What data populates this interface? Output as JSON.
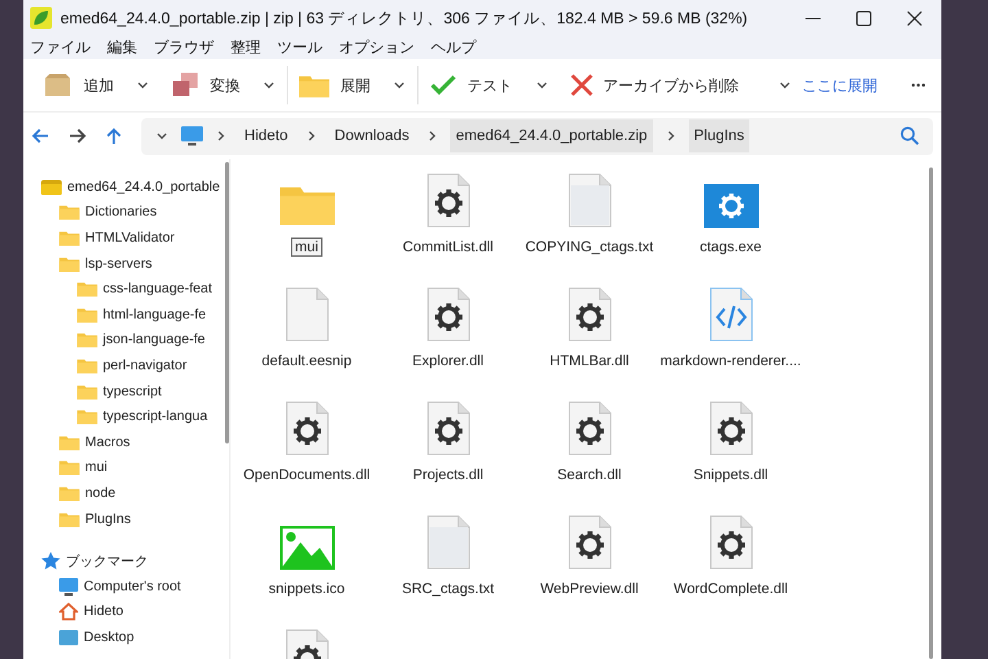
{
  "window": {
    "title": "emed64_24.4.0_portable.zip | zip | 63 ディレクトリ、306 ファイル、182.4 MB > 59.6 MB (32%)"
  },
  "menu": [
    "ファイル",
    "編集",
    "ブラウザ",
    "整理",
    "ツール",
    "オプション",
    "ヘルプ"
  ],
  "toolbar": {
    "buttons": [
      {
        "kind": "add",
        "label": "追加"
      },
      {
        "kind": "convert",
        "label": "変換"
      },
      {
        "kind": "extract",
        "label": "展開"
      },
      {
        "kind": "test",
        "label": "テスト"
      },
      {
        "kind": "delete",
        "label": "アーカイブから削除"
      }
    ],
    "link": "ここに展開"
  },
  "address": {
    "crumbs": [
      {
        "label": "Hideto",
        "selected": false
      },
      {
        "label": "Downloads",
        "selected": false
      },
      {
        "label": "emed64_24.4.0_portable.zip",
        "selected": true
      },
      {
        "label": "PlugIns",
        "selected": true
      }
    ]
  },
  "sidebar": {
    "tree": [
      {
        "label": "emed64_24.4.0_portable",
        "kind": "archive",
        "children": [
          {
            "label": "Dictionaries",
            "kind": "folder"
          },
          {
            "label": "HTMLValidator",
            "kind": "folder"
          },
          {
            "label": "lsp-servers",
            "kind": "folder",
            "children": [
              {
                "label": "css-language-feat",
                "kind": "folder"
              },
              {
                "label": "html-language-fe",
                "kind": "folder"
              },
              {
                "label": "json-language-fe",
                "kind": "folder"
              },
              {
                "label": "perl-navigator",
                "kind": "folder"
              },
              {
                "label": "typescript",
                "kind": "folder"
              },
              {
                "label": "typescript-langua",
                "kind": "folder"
              }
            ]
          },
          {
            "label": "Macros",
            "kind": "folder"
          },
          {
            "label": "mui",
            "kind": "folder"
          },
          {
            "label": "node",
            "kind": "folder"
          },
          {
            "label": "PlugIns",
            "kind": "folder"
          }
        ]
      }
    ],
    "bookmarks": {
      "label": "ブックマーク",
      "items": [
        {
          "label": "Computer's root",
          "kind": "computer"
        },
        {
          "label": "Hideto",
          "kind": "home"
        },
        {
          "label": "Desktop",
          "kind": "desktop"
        }
      ]
    }
  },
  "files": [
    {
      "name": "mui",
      "kind": "folder",
      "selected": true
    },
    {
      "name": "CommitList.dll",
      "kind": "gear",
      "selected": false
    },
    {
      "name": "COPYING_ctags.txt",
      "kind": "blank",
      "selected": false
    },
    {
      "name": "ctags.exe",
      "kind": "exe",
      "selected": false
    },
    {
      "name": "default.eesnip",
      "kind": "plain",
      "selected": false
    },
    {
      "name": "Explorer.dll",
      "kind": "gear",
      "selected": false
    },
    {
      "name": "HTMLBar.dll",
      "kind": "gear",
      "selected": false
    },
    {
      "name": "markdown-renderer....",
      "kind": "code",
      "selected": false
    },
    {
      "name": "OpenDocuments.dll",
      "kind": "gear",
      "selected": false
    },
    {
      "name": "Projects.dll",
      "kind": "gear",
      "selected": false
    },
    {
      "name": "Search.dll",
      "kind": "gear",
      "selected": false
    },
    {
      "name": "Snippets.dll",
      "kind": "gear",
      "selected": false
    },
    {
      "name": "snippets.ico",
      "kind": "image",
      "selected": false
    },
    {
      "name": "SRC_ctags.txt",
      "kind": "blank",
      "selected": false
    },
    {
      "name": "WebPreview.dll",
      "kind": "gear",
      "selected": false
    },
    {
      "name": "WordComplete.dll",
      "kind": "gear",
      "selected": false
    },
    {
      "kind": "gear"
    }
  ]
}
